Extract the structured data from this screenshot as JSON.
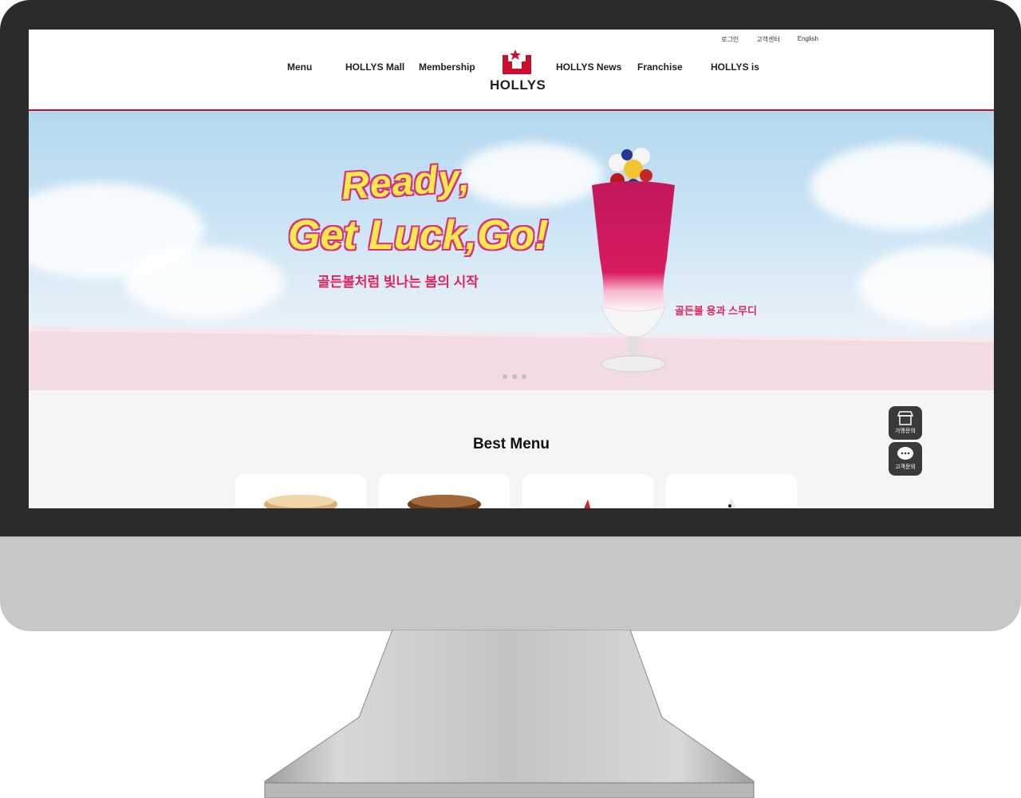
{
  "header": {
    "util_links": [
      "로그인",
      "고객센터",
      "English"
    ],
    "nav_left": [
      "Menu",
      "HOLLYS Mall",
      "Membership"
    ],
    "nav_right": [
      "HOLLYS News",
      "Franchise",
      "HOLLYS is"
    ],
    "logo_text": "HOLLYS"
  },
  "banner": {
    "headline_line1": "Ready,",
    "headline_line2": "Get Luck,Go!",
    "sub_copy": "골든볼처럼 빛나는 봄의 시작",
    "product_name": "골든볼 용과 스무디",
    "slide_count": 3
  },
  "best_menu": {
    "title": "Best Menu"
  },
  "side_buttons": {
    "franchise_label": "가맹문의",
    "customer_label": "고객문의"
  },
  "colors": {
    "brand_red": "#c8102e",
    "headline_yellow": "#f4ea4a",
    "accent_pink": "#e0245e"
  }
}
